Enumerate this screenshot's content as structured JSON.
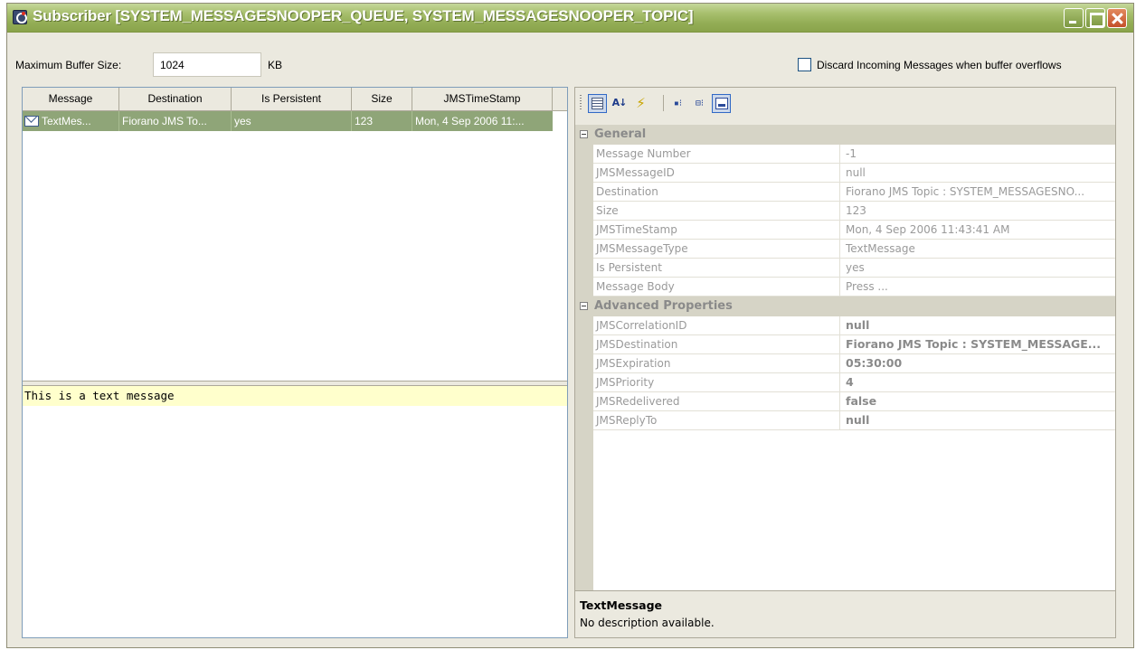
{
  "window": {
    "title": "Subscriber [SYSTEM_MESSAGESNOOPER_QUEUE, SYSTEM_MESSAGESNOOPER_TOPIC]"
  },
  "buffer": {
    "label": "Maximum Buffer Size:",
    "value": "1024",
    "unit": "KB"
  },
  "discard": {
    "label": "Discard Incoming Messages when buffer overflows",
    "checked": false
  },
  "table": {
    "columns": [
      "Message",
      "Destination",
      "Is Persistent",
      "Size",
      "JMSTimeStamp"
    ],
    "rows": [
      {
        "message": "TextMes...",
        "destination": "Fiorano JMS To...",
        "persistent": "yes",
        "size": "123",
        "timestamp": "Mon, 4 Sep 2006 11:..."
      }
    ]
  },
  "message_body": {
    "text": "This is a text message"
  },
  "properties": {
    "toolbar_icons": [
      "categorized-icon",
      "alphabetical-icon",
      "events-icon",
      "expand-all-icon",
      "collapse-all-icon",
      "description-toggle-icon"
    ],
    "general": {
      "title": "General",
      "rows": [
        {
          "name": "Message Number",
          "value": "-1"
        },
        {
          "name": "JMSMessageID",
          "value": "null"
        },
        {
          "name": "Destination",
          "value": "Fiorano JMS Topic : SYSTEM_MESSAGESNO..."
        },
        {
          "name": "Size",
          "value": "123"
        },
        {
          "name": "JMSTimeStamp",
          "value": "Mon, 4 Sep 2006 11:43:41 AM"
        },
        {
          "name": "JMSMessageType",
          "value": "TextMessage"
        },
        {
          "name": "Is Persistent",
          "value": "yes"
        },
        {
          "name": "Message Body",
          "value": "Press ..."
        }
      ]
    },
    "advanced": {
      "title": "Advanced Properties",
      "rows": [
        {
          "name": "JMSCorrelationID",
          "value": "null"
        },
        {
          "name": "JMSDestination",
          "value": "Fiorano JMS Topic : SYSTEM_MESSAGE..."
        },
        {
          "name": "JMSExpiration",
          "value": "05:30:00"
        },
        {
          "name": "JMSPriority",
          "value": "4"
        },
        {
          "name": "JMSRedelivered",
          "value": "false"
        },
        {
          "name": "JMSReplyTo",
          "value": "null"
        }
      ]
    },
    "description": {
      "title": "TextMessage",
      "text": "No description available."
    }
  },
  "colors": {
    "titlebar": "#93ad55",
    "selected_row": "#8fa578",
    "message_highlight": "#ffffcc",
    "window_bg": "#ebe9df"
  }
}
